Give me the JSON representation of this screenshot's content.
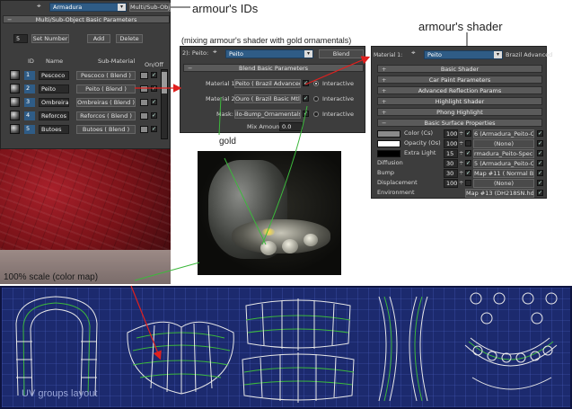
{
  "annotations": {
    "ids": "armour's IDs",
    "shader": "armour's shader",
    "mixing": "(mixing armour's shader with gold ornamentals)",
    "gold": "gold",
    "scale": "100% scale (color map)",
    "uv_layout": "UV groups layout"
  },
  "multisub": {
    "object_dropdown": "Armadura",
    "material_type": "Multi/Sub-Object",
    "rollout": "Multi/Sub-Object Basic Parameters",
    "count": "5",
    "set_number": "Set Number",
    "add": "Add",
    "delete": "Delete",
    "headers": {
      "id": "ID",
      "name": "Name",
      "sub_material": "Sub-Material",
      "onoff": "On/Off"
    },
    "rows": [
      {
        "id": "1",
        "name": "Pescoco",
        "sub": "Pescoco  ( Blend )"
      },
      {
        "id": "2",
        "name": "Peito",
        "sub": "Peito  ( Blend )"
      },
      {
        "id": "3",
        "name": "Ombreiras",
        "sub": "Ombreiras  ( Blend )"
      },
      {
        "id": "4",
        "name": "Reforcos",
        "sub": "Reforcos  ( Blend )"
      },
      {
        "id": "5",
        "name": "Butoes",
        "sub": "Butoes  ( Blend )"
      }
    ]
  },
  "blend": {
    "mat_prefix": "2): Peito:",
    "mat_name": "Peito",
    "mat_type": "Blend",
    "rollout": "Blend Basic Parameters",
    "material1_label": "Material 1:",
    "material1_value": "Peito  ( Brazil Advanced )",
    "material2_label": "Material 2:",
    "material2_value": "Ouro  ( Brazil Basic Mtl )",
    "mask_label": "Mask:",
    "mask_value": "ilo-Bump_Ornamentals.jpg)",
    "interactive": "Interactive",
    "mix_label": "Mix Amount:",
    "mix_value": "0.0"
  },
  "brazil": {
    "mat_prefix": "Material 1:",
    "mat_name": "Peito",
    "mat_type": "Brazil Advanced",
    "rollouts": [
      "Basic Shader",
      "Car Paint Parameters",
      "Advanced Reflection Params",
      "Highlight Shader",
      "Phong Highlight"
    ],
    "surface_rollout": "Basic Surface Properties",
    "rows": [
      {
        "label": "Color (Cs)",
        "value": "100",
        "map": "6 (Armadura_Peito-Color.jpg)",
        "swatch": "#8a8a8a"
      },
      {
        "label": "Opacity (Os)",
        "value": "100",
        "map": "(None)",
        "swatch": "#ffffff"
      },
      {
        "label": "Extra Light",
        "value": "15",
        "map": "rmadura_Peito-Specular.jpg)",
        "swatch": "#000000"
      },
      {
        "label": "Diffusion",
        "value": "30",
        "map": "5 (Armadura_Peito-Color.jpg)",
        "swatch": ""
      },
      {
        "label": "Bump",
        "value": "30",
        "map": "Map #11  ( Normal Bump )",
        "swatch": ""
      },
      {
        "label": "Displacement",
        "value": "100",
        "map": "(None)",
        "swatch": ""
      },
      {
        "label": "Environment",
        "value": "",
        "map": "Map #13 (DH218SN.hdr)",
        "swatch": ""
      }
    ]
  },
  "colors": {
    "arrow_red": "#e0201e",
    "line_green": "#3cb83c",
    "uv_bg": "#1c2a6e",
    "uv_grid": "#4a5fc0",
    "uv_wire": "#e8e8e8"
  }
}
